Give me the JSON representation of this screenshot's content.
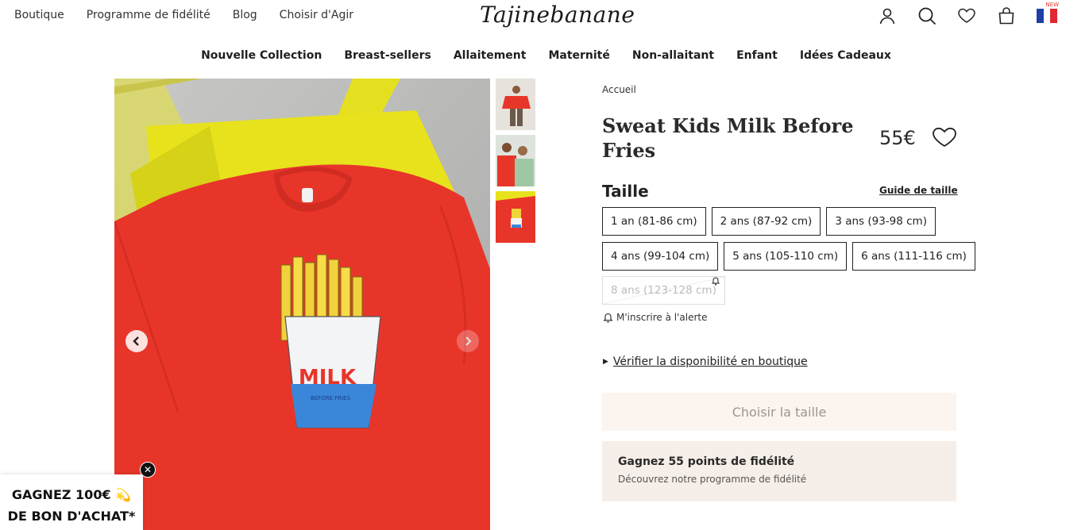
{
  "header": {
    "links": [
      "Boutique",
      "Programme de fidélité",
      "Blog",
      "Choisir d'Agir"
    ],
    "logo": "Tajinebanane",
    "flag_badge": "NEW",
    "icons": [
      "user-icon",
      "search-icon",
      "heart-icon",
      "bag-icon",
      "france-flag-icon"
    ]
  },
  "categories": [
    "Nouvelle Collection",
    "Breast-sellers",
    "Allaitement",
    "Maternité",
    "Non-allaitant",
    "Enfant",
    "Idées Cadeaux"
  ],
  "gallery": {
    "print_text": "MILK",
    "print_subtext": "BEFORE FRIES"
  },
  "product": {
    "breadcrumb": "Accueil",
    "title": "Sweat Kids Milk Before Fries",
    "price": "55€",
    "size_label": "Taille",
    "size_guide": "Guide de taille",
    "sizes_row1": [
      "1 an (81-86 cm)",
      "2 ans (87-92 cm)",
      "3 ans (93-98 cm)"
    ],
    "sizes_row2": [
      "4 ans (99-104 cm)",
      "5 ans (105-110 cm)",
      "6 ans (111-116 cm)"
    ],
    "sizes_row3_unavailable": [
      "8 ans (123-128 cm)"
    ],
    "alert": "M'inscrire à l'alerte",
    "availability": "Vérifier la disponibilité en boutique",
    "cta": "Choisir la taille"
  },
  "loyalty": {
    "title": "Gagnez 55 points de fidélité",
    "subtitle": "Découvrez notre programme de fidélité"
  },
  "promo": {
    "line1": "GAGNEZ 100€ 💫",
    "line2": "DE BON D'ACHAT*"
  },
  "colors": {
    "accent_bg": "#fcf5ef",
    "loyalty_bg": "#f6eee8",
    "sweater_red": "#e8352a",
    "chair_yellow": "#e7e21c"
  }
}
